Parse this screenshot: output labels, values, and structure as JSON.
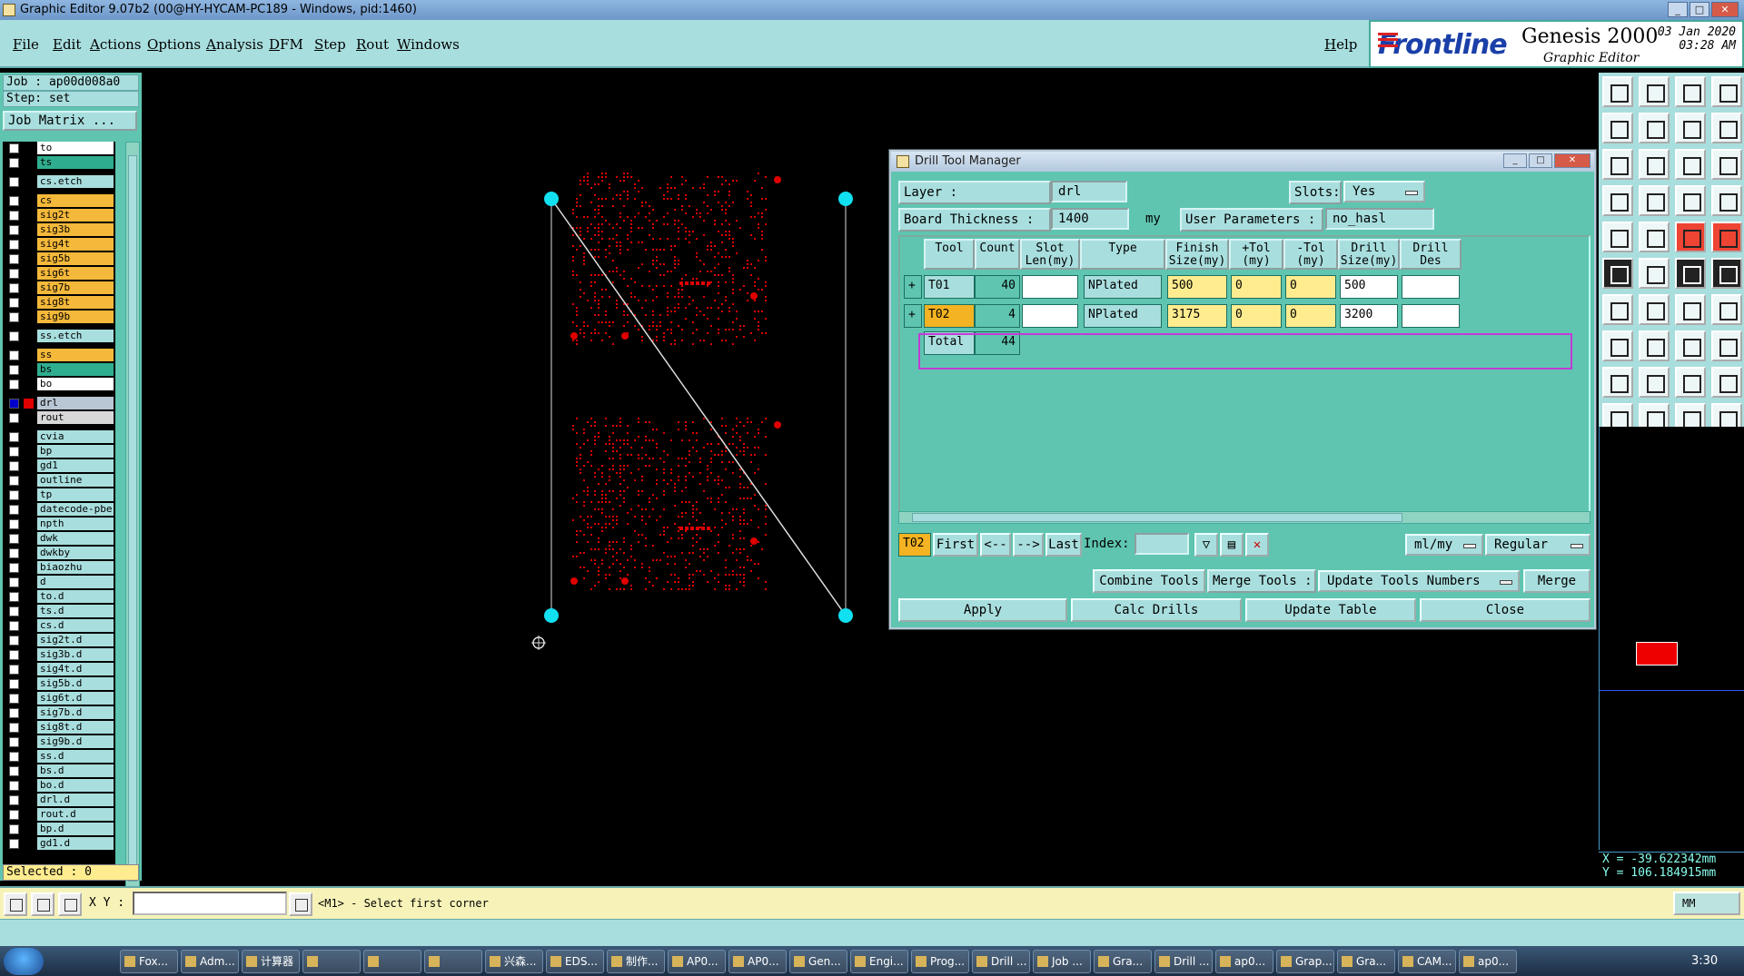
{
  "window": {
    "title": "Graphic Editor 9.07b2 (00@HY-HYCAM-PC189 - Windows, pid:1460)"
  },
  "menu": {
    "items": [
      "File",
      "Edit",
      "Actions",
      "Options",
      "Analysis",
      "DFM",
      "Step",
      "Rout",
      "Windows"
    ],
    "help": "Help"
  },
  "brand": {
    "logo": "Frontline",
    "product": "Genesis 2000",
    "subtitle": "Graphic Editor",
    "date": "03 Jan 2020",
    "time": "03:28 AM"
  },
  "job": {
    "job_line": "Job  : ap00d008a0",
    "step_line": "Step: set",
    "matrix_button": "Job Matrix ..."
  },
  "layers": [
    {
      "name": "to",
      "bg": "#ffffff"
    },
    {
      "name": "ts",
      "bg": "#2fae8f"
    },
    {
      "name": "cs.etch",
      "bg": "#a9dede"
    },
    {
      "name": "cs",
      "bg": "#f4b83a"
    },
    {
      "name": "sig2t",
      "bg": "#f4b83a"
    },
    {
      "name": "sig3b",
      "bg": "#f4b83a"
    },
    {
      "name": "sig4t",
      "bg": "#f4b83a"
    },
    {
      "name": "sig5b",
      "bg": "#f4b83a"
    },
    {
      "name": "sig6t",
      "bg": "#f4b83a"
    },
    {
      "name": "sig7b",
      "bg": "#f4b83a"
    },
    {
      "name": "sig8t",
      "bg": "#f4b83a"
    },
    {
      "name": "sig9b",
      "bg": "#f4b83a"
    },
    {
      "name": "ss.etch",
      "bg": "#a9dede"
    },
    {
      "name": "ss",
      "bg": "#f4b83a"
    },
    {
      "name": "bs",
      "bg": "#2fae8f"
    },
    {
      "name": "bo",
      "bg": "#ffffff"
    },
    {
      "name": "drl",
      "bg": "#b9c6d4",
      "active": true
    },
    {
      "name": "rout",
      "bg": "#d8d8d8"
    },
    {
      "name": "cvia",
      "bg": "#a9dede"
    },
    {
      "name": "bp",
      "bg": "#a9dede"
    },
    {
      "name": "gd1",
      "bg": "#a9dede"
    },
    {
      "name": "outline",
      "bg": "#a9dede"
    },
    {
      "name": "tp",
      "bg": "#a9dede"
    },
    {
      "name": "datecode-pbe",
      "bg": "#a9dede"
    },
    {
      "name": "npth",
      "bg": "#a9dede"
    },
    {
      "name": "dwk",
      "bg": "#a9dede"
    },
    {
      "name": "dwkby",
      "bg": "#a9dede"
    },
    {
      "name": "biaozhu",
      "bg": "#a9dede"
    },
    {
      "name": "d",
      "bg": "#a9dede"
    },
    {
      "name": "to.d",
      "bg": "#a9dede"
    },
    {
      "name": "ts.d",
      "bg": "#a9dede"
    },
    {
      "name": "cs.d",
      "bg": "#a9dede"
    },
    {
      "name": "sig2t.d",
      "bg": "#a9dede"
    },
    {
      "name": "sig3b.d",
      "bg": "#a9dede"
    },
    {
      "name": "sig4t.d",
      "bg": "#a9dede"
    },
    {
      "name": "sig5b.d",
      "bg": "#a9dede"
    },
    {
      "name": "sig6t.d",
      "bg": "#a9dede"
    },
    {
      "name": "sig7b.d",
      "bg": "#a9dede"
    },
    {
      "name": "sig8t.d",
      "bg": "#a9dede"
    },
    {
      "name": "sig9b.d",
      "bg": "#a9dede"
    },
    {
      "name": "ss.d",
      "bg": "#a9dede"
    },
    {
      "name": "bs.d",
      "bg": "#a9dede"
    },
    {
      "name": "bo.d",
      "bg": "#a9dede"
    },
    {
      "name": "drl.d",
      "bg": "#a9dede"
    },
    {
      "name": "rout.d",
      "bg": "#a9dede"
    },
    {
      "name": "bp.d",
      "bg": "#a9dede"
    },
    {
      "name": "gd1.d",
      "bg": "#a9dede"
    }
  ],
  "selected": "Selected : 0",
  "coords": {
    "x": "X = -39.622342mm",
    "y": "Y = 106.184915mm"
  },
  "command": {
    "xy_label": "X Y :",
    "prompt": "<M1> - Select first corner",
    "units": "MM"
  },
  "dialog": {
    "title": "Drill Tool Manager",
    "layer_label": "Layer          :",
    "layer_value": "drl",
    "slots_label": "Slots:",
    "slots_value": "Yes",
    "thickness_label": "Board Thickness :",
    "thickness_value": "1400",
    "thickness_unit": "my",
    "params_label": "User Parameters :",
    "params_value": "no_hasl",
    "headers": [
      "Tool",
      "Count",
      "Slot Len(my)",
      "Type",
      "Finish Size(my)",
      "+Tol (my)",
      "-Tol (my)",
      "Drill Size(my)",
      "Drill Des"
    ],
    "rows": [
      {
        "tool": "T01",
        "count": "40",
        "type": "NPlated",
        "finish": "500",
        "ptol": "0",
        "mtol": "0",
        "drill": "500"
      },
      {
        "tool": "T02",
        "count": "4",
        "type": "NPlated",
        "finish": "3175",
        "ptol": "0",
        "mtol": "0",
        "drill": "3200"
      }
    ],
    "total_label": "Total",
    "total_count": "44",
    "nav": {
      "current": "T02",
      "first": "First",
      "prev": "<--",
      "next": "-->",
      "last": "Last",
      "index_label": "Index:",
      "units": "ml/my",
      "mode": "Regular"
    },
    "actions": {
      "combine": "Combine Tools",
      "merge_label": "Merge Tools :",
      "update_numbers": "Update Tools Numbers",
      "merge": "Merge"
    },
    "buttons": {
      "apply": "Apply",
      "calc": "Calc Drills",
      "update": "Update Table",
      "close": "Close"
    }
  },
  "taskbar": {
    "items": [
      "Fox...",
      "Adm...",
      "计算器",
      "",
      "",
      "",
      "兴森...",
      "EDS...",
      "制作...",
      "AP0...",
      "AP0...",
      "Gen...",
      "Engi...",
      "Prog...",
      "Drill ...",
      "Job ...",
      "Gra...",
      "Drill ...",
      "ap0...",
      "Grap...",
      "Gra...",
      "CAM...",
      "ap0..."
    ],
    "clock": "3:30"
  },
  "colors": {
    "panel": "#5fc5b0",
    "field": "#a9dede",
    "yellow": "#ffec8f",
    "drill": "#e00000",
    "handle": "#10e0f0",
    "highlight": "#c33bd4"
  }
}
